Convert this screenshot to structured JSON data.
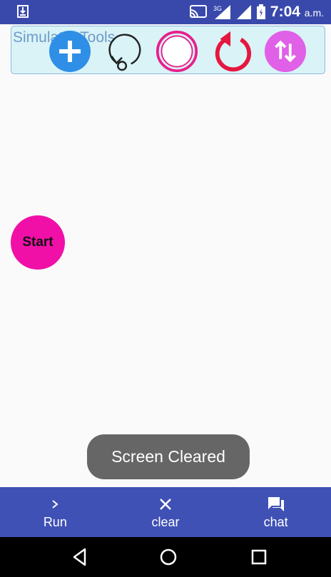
{
  "status_bar": {
    "time": "7:04",
    "time_suffix": "a.m.",
    "network_label": "3G",
    "icons": [
      "download-icon",
      "cast-icon",
      "signal-icon",
      "battery-icon"
    ]
  },
  "tools_panel": {
    "title": "Simulator Tools",
    "tools": [
      {
        "name": "add-icon",
        "color": "#2f8fe6"
      },
      {
        "name": "loop-icon",
        "color": "#222222"
      },
      {
        "name": "circle-target-icon",
        "color": "#e91e8c"
      },
      {
        "name": "rotate-icon",
        "color": "#e5173f"
      },
      {
        "name": "swap-vertical-icon",
        "color": "#e060e8"
      }
    ]
  },
  "start_button": {
    "label": "Start",
    "color": "#f010a8"
  },
  "toast": {
    "text": "Screen Cleared"
  },
  "bottom_nav": {
    "color": "#3f51b5",
    "items": [
      {
        "label": "Run",
        "icon": "chevron-right-icon"
      },
      {
        "label": "clear",
        "icon": "close-icon"
      },
      {
        "label": "chat",
        "icon": "chat-icon"
      }
    ]
  },
  "system_nav": {
    "buttons": [
      "back-icon",
      "home-icon",
      "recents-icon"
    ]
  }
}
